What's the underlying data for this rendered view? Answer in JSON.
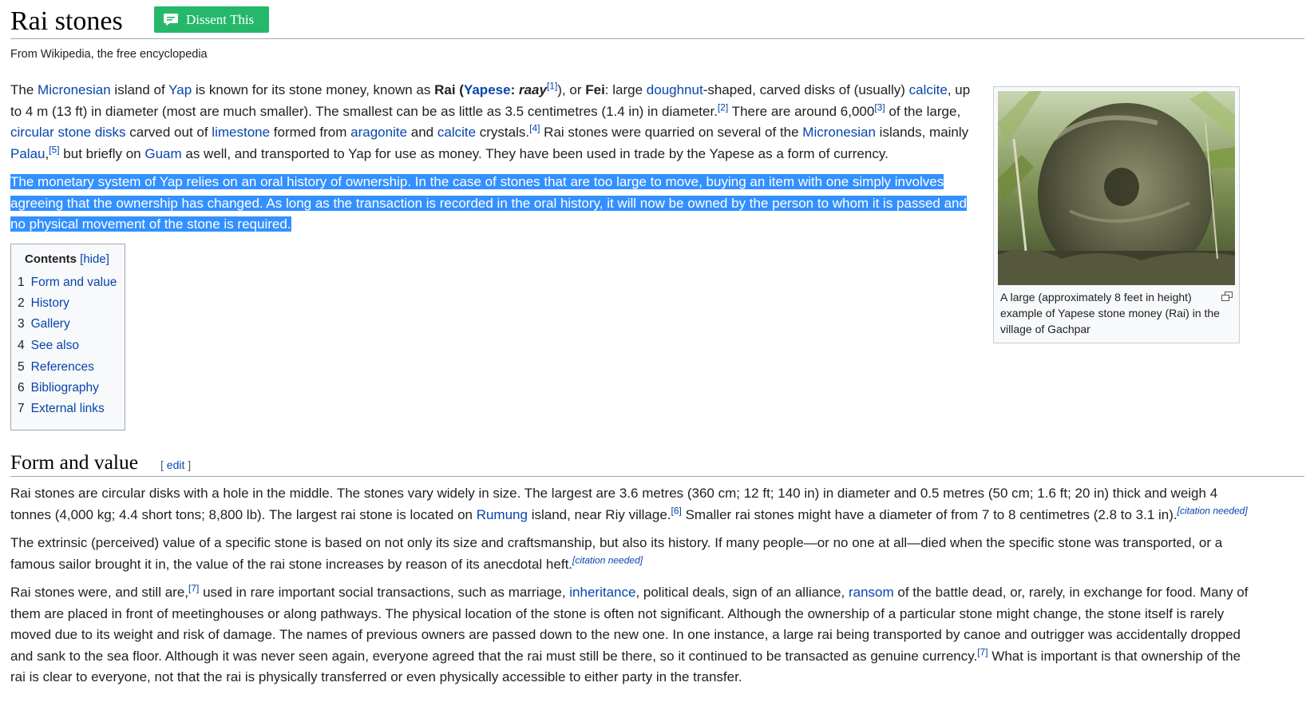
{
  "title": "Rai stones",
  "dissent_label": "Dissent This",
  "tagline": "From Wikipedia, the free encyclopedia",
  "intro": {
    "t1": "The ",
    "l_micronesian": "Micronesian",
    "t2": " island of ",
    "l_yap": "Yap",
    "t3": " is known for its stone money, known as ",
    "rai": "Rai",
    "paren_open": " (",
    "l_yapese": "Yapese",
    "colon": ": ",
    "raay": "raay",
    "ref1": "[1]",
    "t4": "), or ",
    "fei": "Fei",
    "t5": ": large ",
    "l_doughnut": "doughnut",
    "t6": "-shaped, carved disks of (usually) ",
    "l_calcite": "calcite",
    "t7": ", up to 4 m (13 ft) in diameter (most are much smaller). The smallest can be as little as 3.5 centimetres (1.4 in) in diameter.",
    "ref2": "[2]",
    "t8": " There are around 6,000",
    "ref3": "[3]",
    "t9": " of the large, ",
    "l_circular": "circular stone disks",
    "t10": " carved out of ",
    "l_limestone": "limestone",
    "t11": " formed from ",
    "l_aragonite": "aragonite",
    "t12": " and ",
    "l_calcite2": "calcite",
    "t13": " crystals.",
    "ref4": "[4]",
    "t14": " Rai stones were quarried on several of the ",
    "l_micronesian2": "Micronesian",
    "t15": " islands, mainly ",
    "l_palau": "Palau",
    "t16": ",",
    "ref5": "[5]",
    "t17": " but briefly on ",
    "l_guam": "Guam",
    "t18": " as well, and transported to Yap for use as money. They have been used in trade by the Yapese as a form of currency."
  },
  "highlighted": "The monetary system of Yap relies on an oral history of ownership. In the case of stones that are too large to move, buying an item with one simply involves agreeing that the ownership has changed. As long as the transaction is recorded in the oral history, it will now be owned by the person to whom it is passed and no physical movement of the stone is required.",
  "figure": {
    "caption": "A large (approximately 8 feet in height) example of Yapese stone money (Rai) in the village of Gachpar"
  },
  "toc": {
    "title": "Contents",
    "hide": "[hide]",
    "items": [
      {
        "num": "1",
        "label": "Form and value"
      },
      {
        "num": "2",
        "label": "History"
      },
      {
        "num": "3",
        "label": "Gallery"
      },
      {
        "num": "4",
        "label": "See also"
      },
      {
        "num": "5",
        "label": "References"
      },
      {
        "num": "6",
        "label": "Bibliography"
      },
      {
        "num": "7",
        "label": "External links"
      }
    ]
  },
  "section": {
    "title": "Form and value",
    "edit_open": "[ ",
    "edit": "edit",
    "edit_close": " ]"
  },
  "p1": {
    "t1": "Rai stones are circular disks with a hole in the middle. The stones vary widely in size. The largest are 3.6 metres (360 cm; 12 ft; 140 in) in diameter and 0.5 metres (50 cm; 1.6 ft; 20 in) thick and weigh 4 tonnes (4,000 kg; 4.4 short tons; 8,800 lb). The largest rai stone is located on ",
    "l_rumung": "Rumung",
    "t2": " island, near Riy village.",
    "ref6": "[6]",
    "t3": " Smaller rai stones might have a diameter of from 7 to 8 centimetres (2.8 to 3.1 in).",
    "cn": "[citation needed]"
  },
  "p2": {
    "t1": "The extrinsic (perceived) value of a specific stone is based on not only its size and craftsmanship, but also its history. If many people—or no one at all—died when the specific stone was transported, or a famous sailor brought it in, the value of the rai stone increases by reason of its anecdotal heft.",
    "cn": "[citation needed]"
  },
  "p3": {
    "t1": "Rai stones were, and still are,",
    "ref7": "[7]",
    "t2": " used in rare important social transactions, such as marriage, ",
    "l_inheritance": "inheritance",
    "t3": ", political deals, sign of an alliance, ",
    "l_ransom": "ransom",
    "t4": " of the battle dead, or, rarely, in exchange for food. Many of them are placed in front of meetinghouses or along pathways. The physical location of the stone is often not significant. Although the ownership of a particular stone might change, the stone itself is rarely moved due to its weight and risk of damage. The names of previous owners are passed down to the new one. In one instance, a large rai being transported by canoe and outrigger was accidentally dropped and sank to the sea floor. Although it was never seen again, everyone agreed that the rai must still be there, so it continued to be transacted as genuine currency.",
    "ref7b": "[7]",
    "t5": " What is important is that ownership of the rai is clear to everyone, not that the rai is physically transferred or even physically accessible to either party in the transfer."
  },
  "colors": {
    "link": "#0645ad",
    "selection": "#3390ff",
    "dissent_green": "#25b86b"
  }
}
